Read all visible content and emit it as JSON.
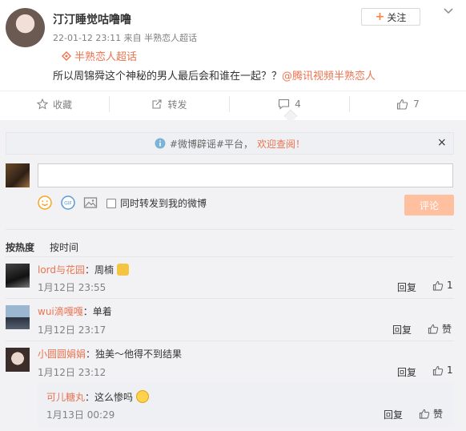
{
  "post": {
    "username": "汀汀睡觉咕噜噜",
    "meta": "22-01-12 23:11 来自 半熟恋人超话",
    "follow_label": "关注",
    "tag": "半熟恋人超话",
    "content_text": "所以周锦舜这个神秘的男人最后会和谁在一起？？",
    "content_link": "@腾讯视频半熟恋人"
  },
  "actions": {
    "favorite_label": "收藏",
    "repost_label": "转发",
    "comment_count": "4",
    "like_count": "7"
  },
  "notice": {
    "text": "#微博辟谣#平台，",
    "link": "欢迎查阅！",
    "close": "×"
  },
  "composer": {
    "repost_check_label": "同时转发到我的微博",
    "submit_label": "评论"
  },
  "sort": {
    "hot_label": "按热度",
    "time_label": "按时间"
  },
  "comments": [
    {
      "nick": "lord与花园",
      "text": "：周楠",
      "time": "1月12日 23:55",
      "reply": "回复",
      "like": "1"
    },
    {
      "nick": "wui滴嘎嘎",
      "text": "：单着",
      "time": "1月12日 23:17",
      "reply": "回复",
      "like": "赞"
    },
    {
      "nick": "小圆圆娟娟",
      "text": "：独美～他得不到结果",
      "time": "1月12日 23:12",
      "reply": "回复",
      "like": "1"
    }
  ],
  "sub_comment": {
    "nick": "可儿糖丸",
    "text": "：这么惨吗",
    "time": "1月13日 00:29",
    "reply": "回复",
    "like": "赞"
  },
  "colors": {
    "accent": "#eb7350",
    "submit_bg": "#ffc09f",
    "notice_bg": "#eef0f3"
  }
}
